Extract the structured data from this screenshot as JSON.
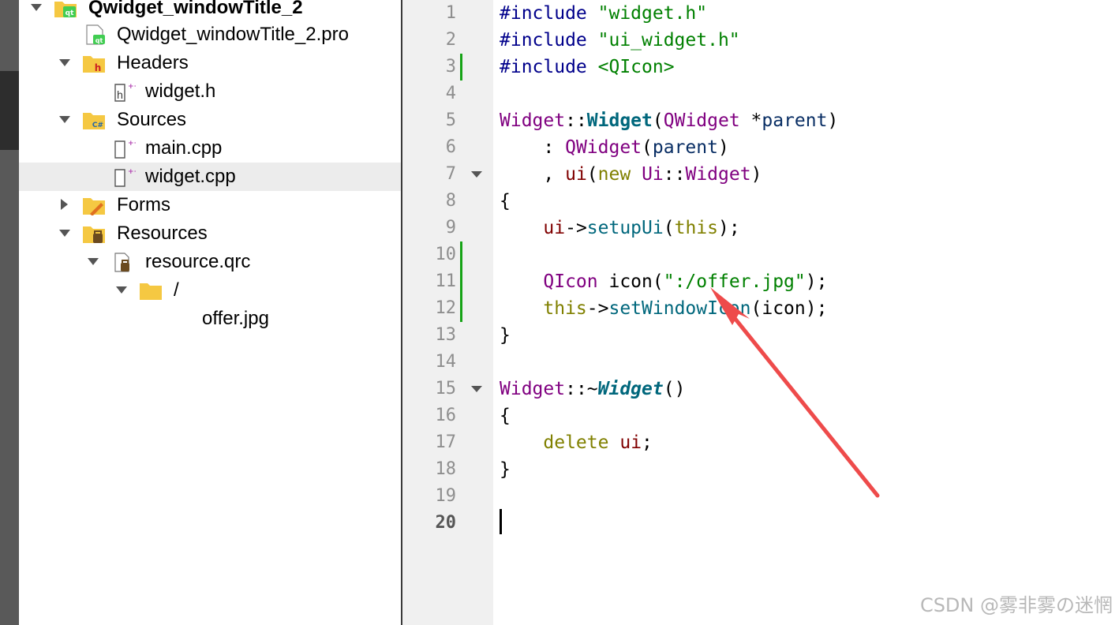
{
  "project_tree": {
    "project": {
      "label": "Qwidget_windowTitle_2"
    },
    "pro_file": {
      "label": "Qwidget_windowTitle_2.pro"
    },
    "headers": {
      "label": "Headers"
    },
    "widget_h": {
      "label": "widget.h"
    },
    "sources": {
      "label": "Sources"
    },
    "main_cpp": {
      "label": "main.cpp"
    },
    "widget_cpp": {
      "label": "widget.cpp"
    },
    "forms": {
      "label": "Forms"
    },
    "resources": {
      "label": "Resources"
    },
    "resource_qrc": {
      "label": "resource.qrc"
    },
    "prefix": {
      "label": "/"
    },
    "offer_jpg": {
      "label": "offer.jpg"
    }
  },
  "editor": {
    "line_numbers": [
      "1",
      "2",
      "3",
      "4",
      "5",
      "6",
      "7",
      "8",
      "9",
      "10",
      "11",
      "12",
      "13",
      "14",
      "15",
      "16",
      "17",
      "18",
      "19",
      "20"
    ],
    "current_line": "20",
    "lines": [
      [
        {
          "t": "#include ",
          "c": "pre"
        },
        {
          "t": "\"widget.h\"",
          "c": "str"
        }
      ],
      [
        {
          "t": "#include ",
          "c": "pre"
        },
        {
          "t": "\"ui_widget.h\"",
          "c": "str"
        }
      ],
      [
        {
          "t": "#include ",
          "c": "pre"
        },
        {
          "t": "<QIcon>",
          "c": "str"
        }
      ],
      [],
      [
        {
          "t": "Widget",
          "c": "type"
        },
        {
          "t": "::",
          "c": "plain"
        },
        {
          "t": "Widget",
          "c": "fn"
        },
        {
          "t": "(",
          "c": "plain"
        },
        {
          "t": "QWidget",
          "c": "type"
        },
        {
          "t": " *",
          "c": "plain"
        },
        {
          "t": "parent",
          "c": "var"
        },
        {
          "t": ")",
          "c": "plain"
        }
      ],
      [
        {
          "t": "    : ",
          "c": "plain"
        },
        {
          "t": "QWidget",
          "c": "type"
        },
        {
          "t": "(",
          "c": "plain"
        },
        {
          "t": "parent",
          "c": "var"
        },
        {
          "t": ")",
          "c": "plain"
        }
      ],
      [
        {
          "t": "    , ",
          "c": "plain"
        },
        {
          "t": "ui",
          "c": "mem"
        },
        {
          "t": "(",
          "c": "plain"
        },
        {
          "t": "new",
          "c": "kw"
        },
        {
          "t": " ",
          "c": "plain"
        },
        {
          "t": "Ui",
          "c": "type"
        },
        {
          "t": "::",
          "c": "plain"
        },
        {
          "t": "Widget",
          "c": "type"
        },
        {
          "t": ")",
          "c": "plain"
        }
      ],
      [
        {
          "t": "{",
          "c": "plain"
        }
      ],
      [
        {
          "t": "    ",
          "c": "plain"
        },
        {
          "t": "ui",
          "c": "mem"
        },
        {
          "t": "->",
          "c": "plain"
        },
        {
          "t": "setupUi",
          "c": "call"
        },
        {
          "t": "(",
          "c": "plain"
        },
        {
          "t": "this",
          "c": "kw"
        },
        {
          "t": ");",
          "c": "plain"
        }
      ],
      [],
      [
        {
          "t": "    ",
          "c": "plain"
        },
        {
          "t": "QIcon",
          "c": "type"
        },
        {
          "t": " icon(",
          "c": "plain"
        },
        {
          "t": "\":/offer.jpg\"",
          "c": "str"
        },
        {
          "t": ");",
          "c": "plain"
        }
      ],
      [
        {
          "t": "    ",
          "c": "plain"
        },
        {
          "t": "this",
          "c": "kw"
        },
        {
          "t": "->",
          "c": "plain"
        },
        {
          "t": "setWindowIcon",
          "c": "call"
        },
        {
          "t": "(icon);",
          "c": "plain"
        }
      ],
      [
        {
          "t": "}",
          "c": "plain"
        }
      ],
      [],
      [
        {
          "t": "Widget",
          "c": "type"
        },
        {
          "t": "::~",
          "c": "plain"
        },
        {
          "t": "Widget",
          "c": "fni"
        },
        {
          "t": "()",
          "c": "plain"
        }
      ],
      [
        {
          "t": "{",
          "c": "plain"
        }
      ],
      [
        {
          "t": "    ",
          "c": "plain"
        },
        {
          "t": "delete",
          "c": "kw"
        },
        {
          "t": " ",
          "c": "plain"
        },
        {
          "t": "ui",
          "c": "mem"
        },
        {
          "t": ";",
          "c": "plain"
        }
      ],
      [
        {
          "t": "}",
          "c": "plain"
        }
      ],
      [],
      []
    ],
    "change_marker_lines": [
      "3",
      "10",
      "11",
      "12"
    ],
    "fold_marker_lines": [
      "7",
      "15"
    ]
  },
  "watermark": {
    "text": "CSDN @雾非雾の迷惘"
  },
  "colors": {
    "annotation_arrow": "#ee4b4b",
    "change_marker": "#16a316",
    "preprocessor": "#00008b",
    "string": "#008000",
    "type": "#800080",
    "keyword": "#808000"
  }
}
